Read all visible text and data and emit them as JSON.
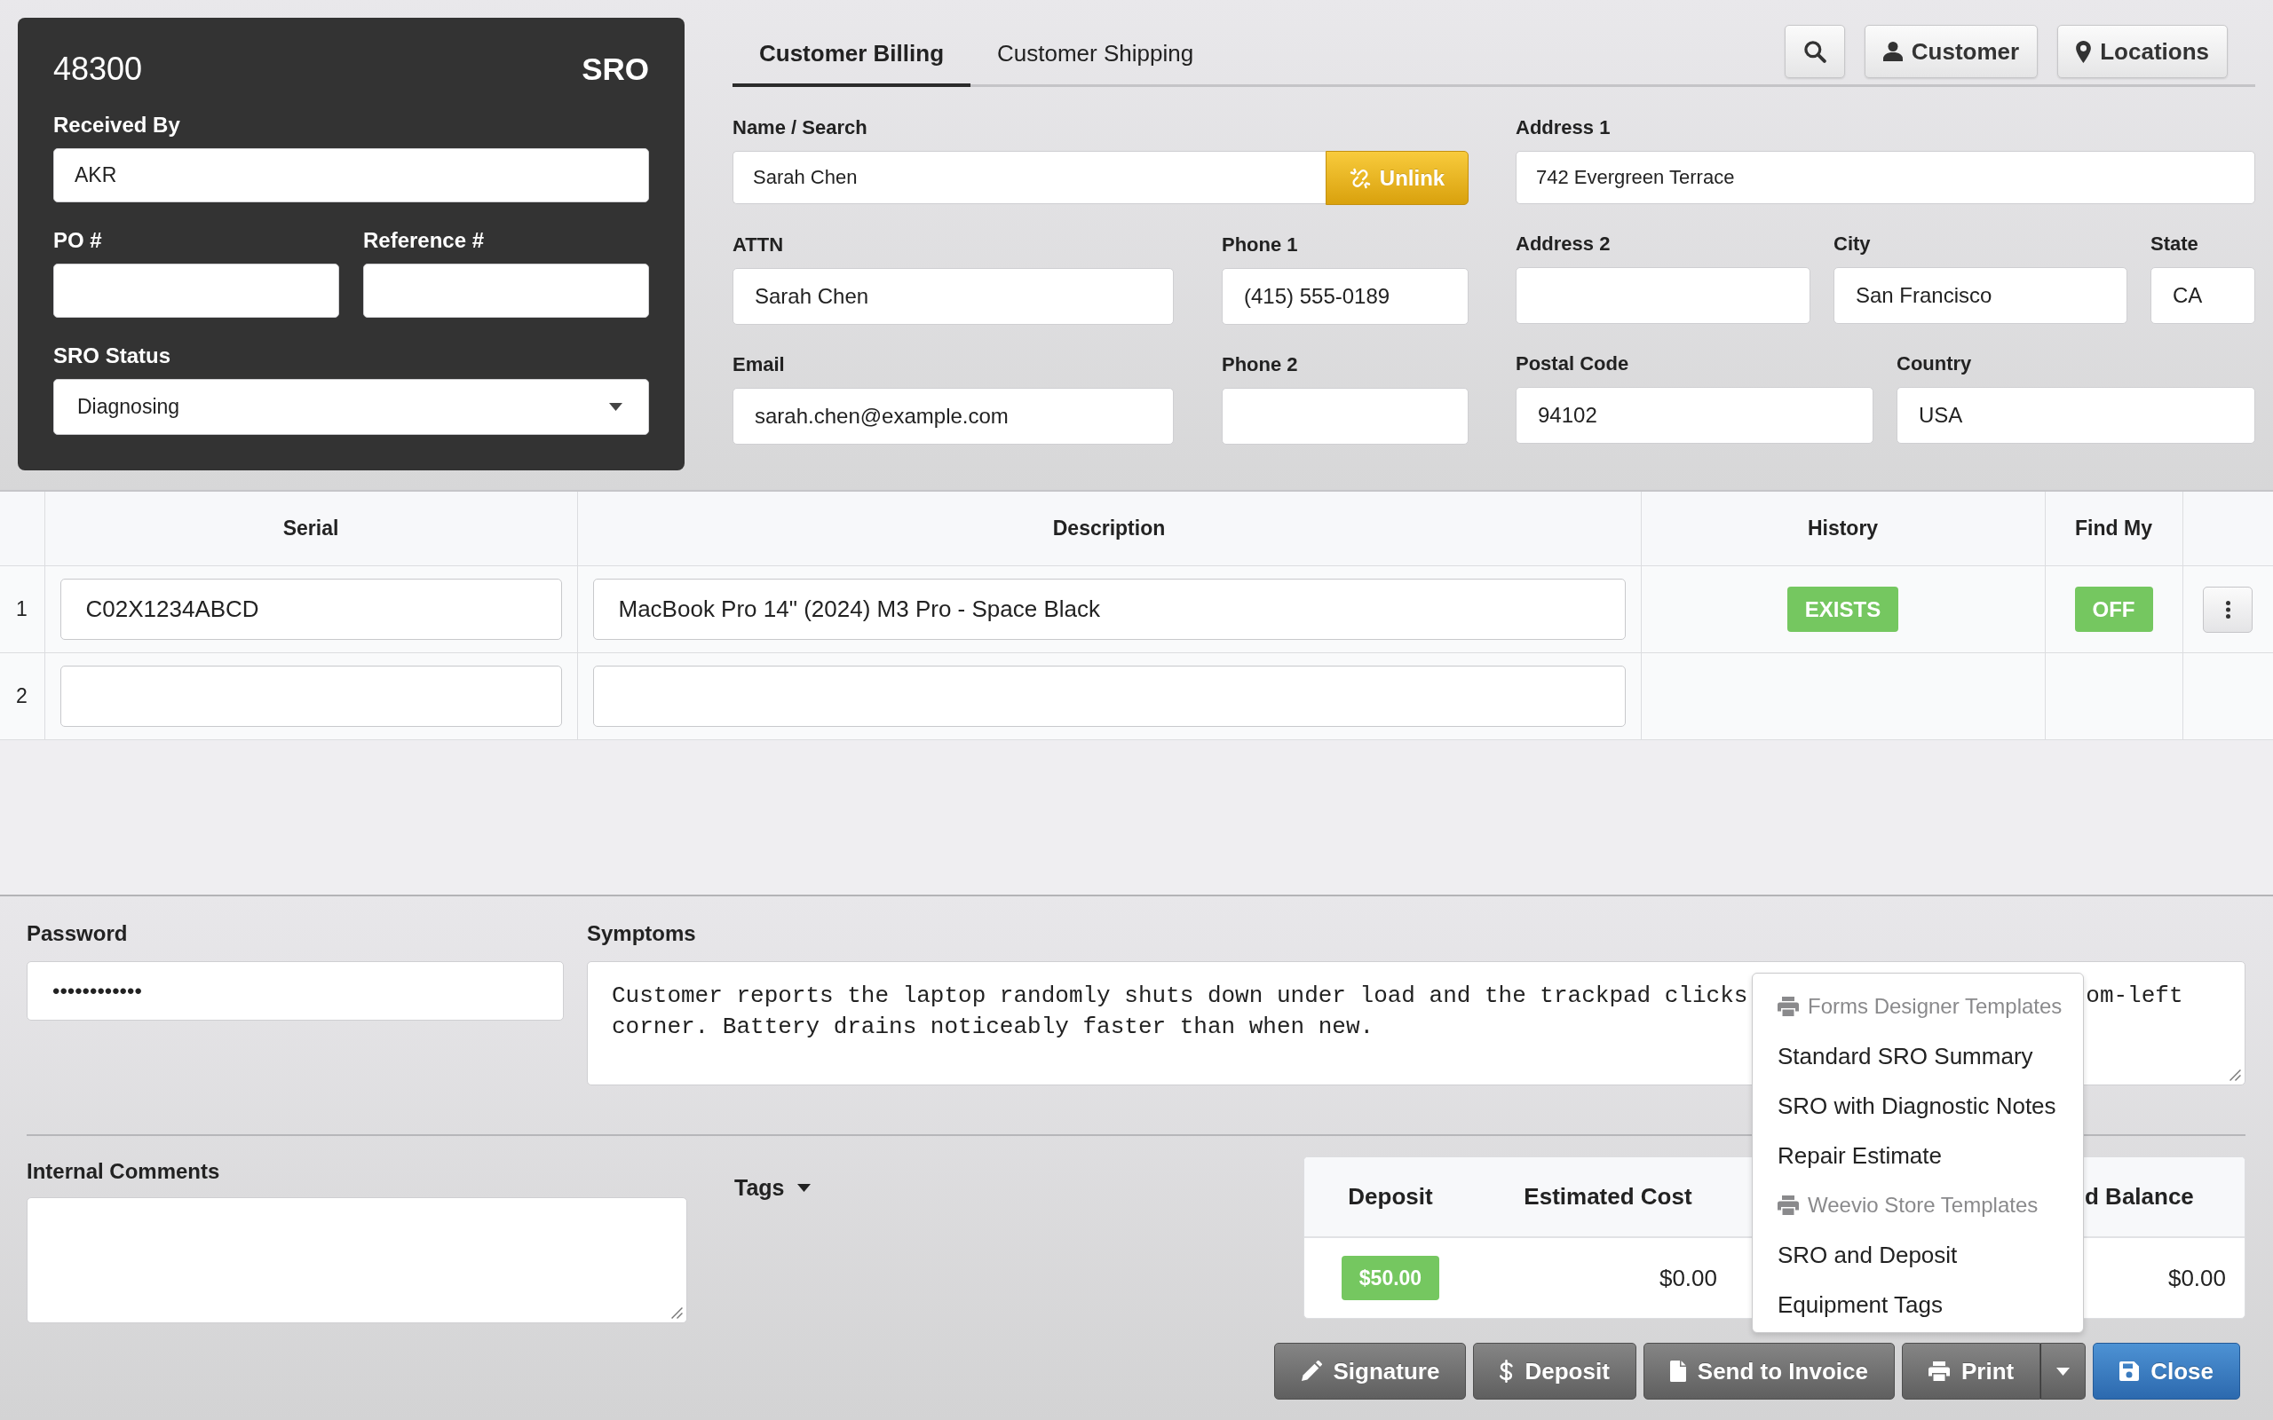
{
  "sro_panel": {
    "number": "48300",
    "type": "SRO",
    "received_by": {
      "label": "Received By",
      "value": "AKR"
    },
    "po_number": {
      "label": "PO #"
    },
    "reference_number": {
      "label": "Reference #"
    },
    "status": {
      "label": "SRO Status",
      "value": "Diagnosing"
    }
  },
  "customer": {
    "tabs": [
      {
        "label": "Customer Billing",
        "selected": true
      },
      {
        "label": "Customer Shipping",
        "selected": false
      }
    ],
    "toolbar": [
      {
        "kind": "search"
      },
      {
        "kind": "person",
        "label": "Customer"
      },
      {
        "kind": "pin",
        "label": "Locations"
      }
    ],
    "name_search": {
      "label": "Name / Search",
      "value": "Sarah Chen",
      "button": "Unlink"
    },
    "attn": {
      "label": "ATTN",
      "value": "Sarah Chen"
    },
    "phone_1": {
      "label": "Phone 1",
      "value": "(415) 555-0189"
    },
    "email": {
      "label": "Email",
      "value": "sarah.chen@example.com"
    },
    "phone_2": {
      "label": "Phone 2"
    },
    "address_1": {
      "label": "Address 1",
      "value": "742 Evergreen Terrace"
    },
    "address_2": {
      "label": "Address 2"
    },
    "city": {
      "label": "City",
      "value": "San Francisco"
    },
    "state": {
      "label": "State",
      "value": "CA"
    },
    "postal_code": {
      "label": "Postal Code",
      "value": "94102"
    },
    "country": {
      "label": "Country",
      "value": "USA"
    }
  },
  "equipment_table": {
    "columns": [
      "Serial",
      "Description",
      "History",
      "Find My"
    ],
    "rows": [
      {
        "number": "1",
        "serial": "C02X1234ABCD",
        "description": "MacBook Pro 14\" (2024) M3 Pro - Space Black",
        "history": "EXISTS",
        "find_my": "OFF",
        "menu_button": true
      },
      {
        "number": "2",
        "menu_button": false
      }
    ]
  },
  "password": {
    "label": "Password",
    "value": "••••••••••••"
  },
  "symptoms": {
    "label": "Symptoms",
    "visible_lines": [
      [
        "Customer reports the laptop randomly shuts down under load and the trackpad clicks",
        "om-left"
      ],
      [
        "corner. Battery drains noticeably faster than when new."
      ]
    ]
  },
  "internal_comments": {
    "label": "Internal Comments"
  },
  "tags": {
    "label": "Tags"
  },
  "summary": [
    {
      "header": "Deposit",
      "value": "$50.00",
      "kind": "badge"
    },
    {
      "header": "Estimated Cost",
      "value": "$0.00",
      "kind": "amount"
    },
    {
      "header": "d Balance",
      "value": "$0.00",
      "kind": "amount"
    }
  ],
  "actions": [
    {
      "label": "Signature",
      "kind": "plain"
    },
    {
      "label": "Deposit",
      "kind": "plain"
    },
    {
      "label": "Send to Invoice",
      "kind": "plain"
    },
    {
      "label": "Print",
      "kind": "split"
    },
    {
      "label": "Close",
      "kind": "primary"
    }
  ],
  "print_menu": [
    {
      "header": "Forms Designer Templates",
      "items": [
        "Standard SRO Summary",
        "SRO with Diagnostic Notes",
        "Repair Estimate"
      ]
    },
    {
      "header": "Weevio Store Templates",
      "items": [
        "SRO and Deposit",
        "Equipment Tags"
      ]
    }
  ]
}
